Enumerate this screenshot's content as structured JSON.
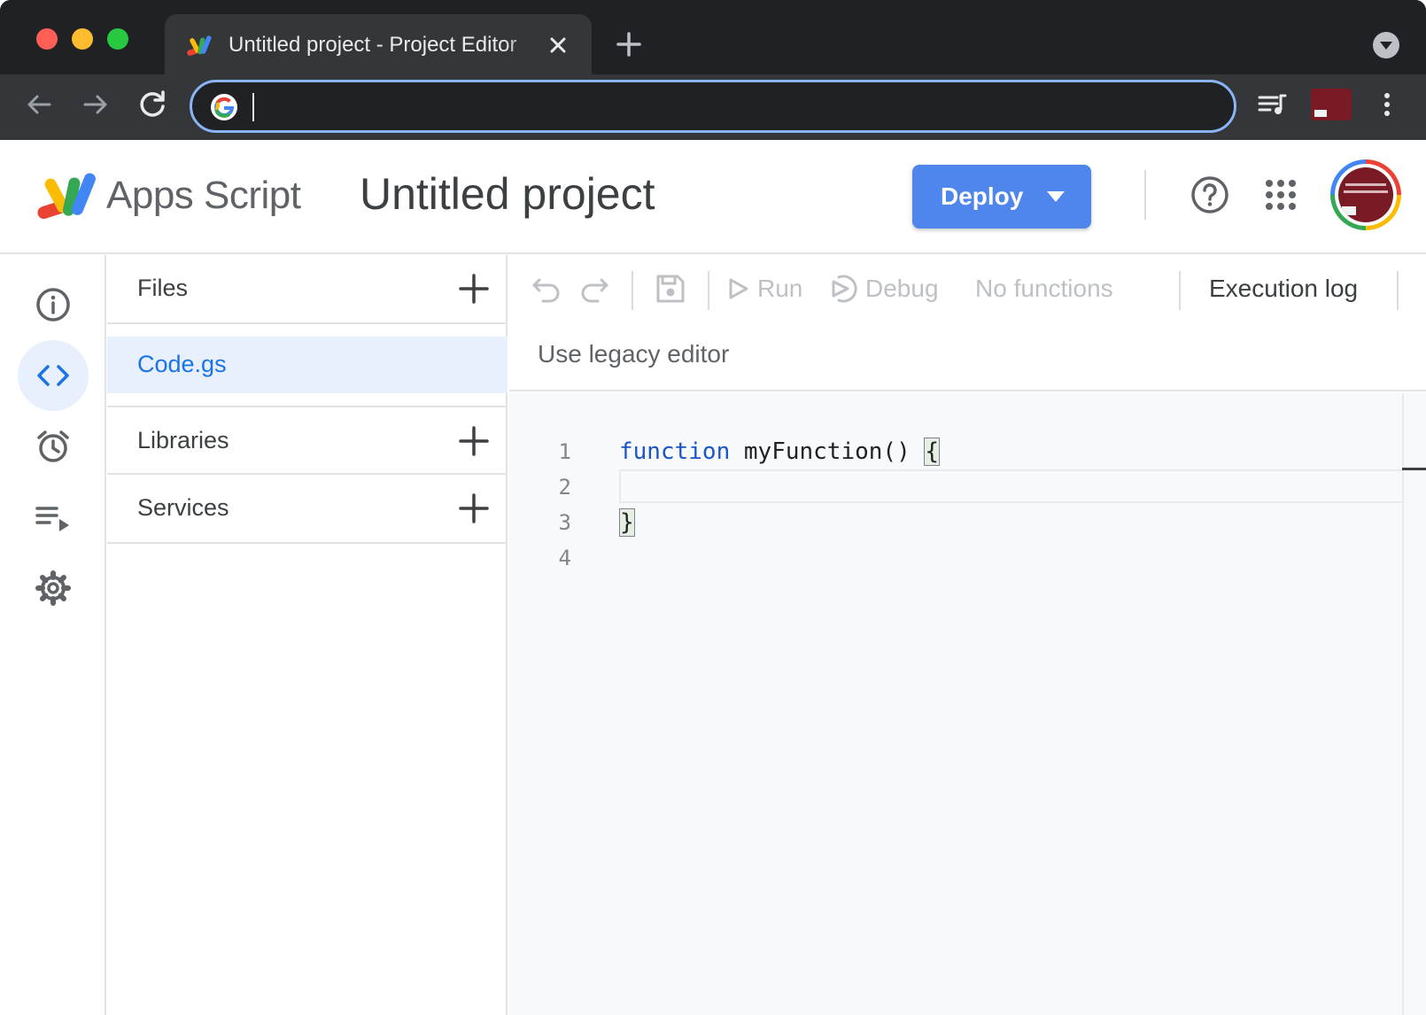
{
  "browser": {
    "tab_title": "Untitled project - Project Editor",
    "omnibox_value": ""
  },
  "header": {
    "brand": "Apps Script",
    "project_title": "Untitled project",
    "deploy_label": "Deploy"
  },
  "files_panel": {
    "files_label": "Files",
    "files": [
      {
        "name": "Code.gs",
        "selected": true
      }
    ],
    "libraries_label": "Libraries",
    "services_label": "Services"
  },
  "editor_toolbar": {
    "run_label": "Run",
    "debug_label": "Debug",
    "function_select": "No functions",
    "execution_log_label": "Execution log"
  },
  "legacy_link": "Use legacy editor",
  "code": {
    "line_numbers": [
      "1",
      "2",
      "3",
      "4"
    ],
    "keyword": "function",
    "function_signature": " myFunction() ",
    "open_brace": "{",
    "close_brace": "}"
  },
  "colors": {
    "accent": "#4f86ec",
    "link": "#1a73e8",
    "selected_bg": "#e8f0fe",
    "browser_dark": "#202124"
  },
  "icons": {
    "rail": [
      "info-icon",
      "code-icon",
      "alarm-icon",
      "executions-icon",
      "settings-icon"
    ],
    "toolbar": [
      "undo-icon",
      "redo-icon",
      "save-icon",
      "play-icon",
      "debug-icon"
    ]
  }
}
